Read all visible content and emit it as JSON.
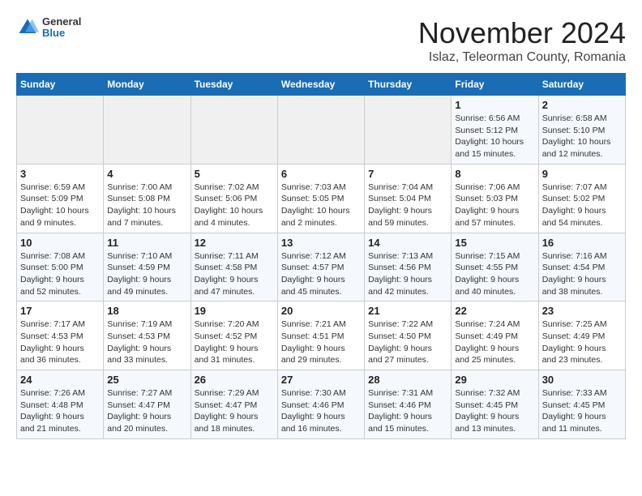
{
  "header": {
    "logo_general": "General",
    "logo_blue": "Blue",
    "month_title": "November 2024",
    "subtitle": "Islaz, Teleorman County, Romania"
  },
  "days_of_week": [
    "Sunday",
    "Monday",
    "Tuesday",
    "Wednesday",
    "Thursday",
    "Friday",
    "Saturday"
  ],
  "weeks": [
    [
      {
        "day": "",
        "empty": true
      },
      {
        "day": "",
        "empty": true
      },
      {
        "day": "",
        "empty": true
      },
      {
        "day": "",
        "empty": true
      },
      {
        "day": "",
        "empty": true
      },
      {
        "day": "1",
        "sunrise": "6:56 AM",
        "sunset": "5:12 PM",
        "daylight": "10 hours and 15 minutes."
      },
      {
        "day": "2",
        "sunrise": "6:58 AM",
        "sunset": "5:10 PM",
        "daylight": "10 hours and 12 minutes."
      }
    ],
    [
      {
        "day": "3",
        "sunrise": "6:59 AM",
        "sunset": "5:09 PM",
        "daylight": "10 hours and 9 minutes."
      },
      {
        "day": "4",
        "sunrise": "7:00 AM",
        "sunset": "5:08 PM",
        "daylight": "10 hours and 7 minutes."
      },
      {
        "day": "5",
        "sunrise": "7:02 AM",
        "sunset": "5:06 PM",
        "daylight": "10 hours and 4 minutes."
      },
      {
        "day": "6",
        "sunrise": "7:03 AM",
        "sunset": "5:05 PM",
        "daylight": "10 hours and 2 minutes."
      },
      {
        "day": "7",
        "sunrise": "7:04 AM",
        "sunset": "5:04 PM",
        "daylight": "9 hours and 59 minutes."
      },
      {
        "day": "8",
        "sunrise": "7:06 AM",
        "sunset": "5:03 PM",
        "daylight": "9 hours and 57 minutes."
      },
      {
        "day": "9",
        "sunrise": "7:07 AM",
        "sunset": "5:02 PM",
        "daylight": "9 hours and 54 minutes."
      }
    ],
    [
      {
        "day": "10",
        "sunrise": "7:08 AM",
        "sunset": "5:00 PM",
        "daylight": "9 hours and 52 minutes."
      },
      {
        "day": "11",
        "sunrise": "7:10 AM",
        "sunset": "4:59 PM",
        "daylight": "9 hours and 49 minutes."
      },
      {
        "day": "12",
        "sunrise": "7:11 AM",
        "sunset": "4:58 PM",
        "daylight": "9 hours and 47 minutes."
      },
      {
        "day": "13",
        "sunrise": "7:12 AM",
        "sunset": "4:57 PM",
        "daylight": "9 hours and 45 minutes."
      },
      {
        "day": "14",
        "sunrise": "7:13 AM",
        "sunset": "4:56 PM",
        "daylight": "9 hours and 42 minutes."
      },
      {
        "day": "15",
        "sunrise": "7:15 AM",
        "sunset": "4:55 PM",
        "daylight": "9 hours and 40 minutes."
      },
      {
        "day": "16",
        "sunrise": "7:16 AM",
        "sunset": "4:54 PM",
        "daylight": "9 hours and 38 minutes."
      }
    ],
    [
      {
        "day": "17",
        "sunrise": "7:17 AM",
        "sunset": "4:53 PM",
        "daylight": "9 hours and 36 minutes."
      },
      {
        "day": "18",
        "sunrise": "7:19 AM",
        "sunset": "4:53 PM",
        "daylight": "9 hours and 33 minutes."
      },
      {
        "day": "19",
        "sunrise": "7:20 AM",
        "sunset": "4:52 PM",
        "daylight": "9 hours and 31 minutes."
      },
      {
        "day": "20",
        "sunrise": "7:21 AM",
        "sunset": "4:51 PM",
        "daylight": "9 hours and 29 minutes."
      },
      {
        "day": "21",
        "sunrise": "7:22 AM",
        "sunset": "4:50 PM",
        "daylight": "9 hours and 27 minutes."
      },
      {
        "day": "22",
        "sunrise": "7:24 AM",
        "sunset": "4:49 PM",
        "daylight": "9 hours and 25 minutes."
      },
      {
        "day": "23",
        "sunrise": "7:25 AM",
        "sunset": "4:49 PM",
        "daylight": "9 hours and 23 minutes."
      }
    ],
    [
      {
        "day": "24",
        "sunrise": "7:26 AM",
        "sunset": "4:48 PM",
        "daylight": "9 hours and 21 minutes."
      },
      {
        "day": "25",
        "sunrise": "7:27 AM",
        "sunset": "4:47 PM",
        "daylight": "9 hours and 20 minutes."
      },
      {
        "day": "26",
        "sunrise": "7:29 AM",
        "sunset": "4:47 PM",
        "daylight": "9 hours and 18 minutes."
      },
      {
        "day": "27",
        "sunrise": "7:30 AM",
        "sunset": "4:46 PM",
        "daylight": "9 hours and 16 minutes."
      },
      {
        "day": "28",
        "sunrise": "7:31 AM",
        "sunset": "4:46 PM",
        "daylight": "9 hours and 15 minutes."
      },
      {
        "day": "29",
        "sunrise": "7:32 AM",
        "sunset": "4:45 PM",
        "daylight": "9 hours and 13 minutes."
      },
      {
        "day": "30",
        "sunrise": "7:33 AM",
        "sunset": "4:45 PM",
        "daylight": "9 hours and 11 minutes."
      }
    ]
  ]
}
